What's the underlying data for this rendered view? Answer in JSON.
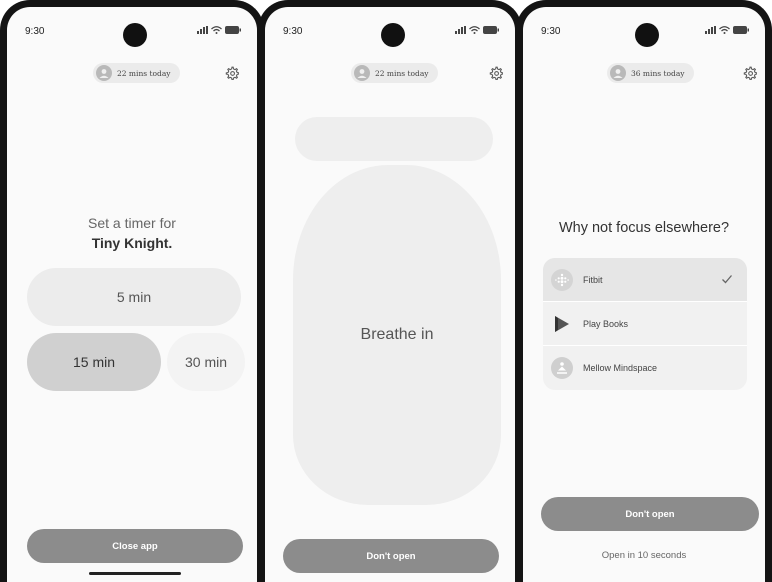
{
  "status": {
    "time": "9:30"
  },
  "screens": {
    "timer": {
      "usage": "22 mins today",
      "prompt": "Set a timer for",
      "app_name": "Tiny Knight.",
      "options": [
        "5 min",
        "15 min",
        "30 min"
      ],
      "selected_option": "15 min",
      "close_label": "Close app"
    },
    "breathe": {
      "usage": "22 mins today",
      "breathe_text": "Breathe in",
      "dont_open_label": "Don't open"
    },
    "focus": {
      "usage": "36 mins today",
      "title": "Why not focus elsewhere?",
      "apps": [
        {
          "label": "Fitbit",
          "icon": "fitbit-icon",
          "checked": true
        },
        {
          "label": "Play Books",
          "icon": "play-books-icon",
          "checked": false
        },
        {
          "label": "Mellow Mindspace",
          "icon": "mellow-mindspace-icon",
          "checked": false
        }
      ],
      "dont_open_label": "Don't open",
      "open_countdown": "Open in 10 seconds"
    }
  }
}
